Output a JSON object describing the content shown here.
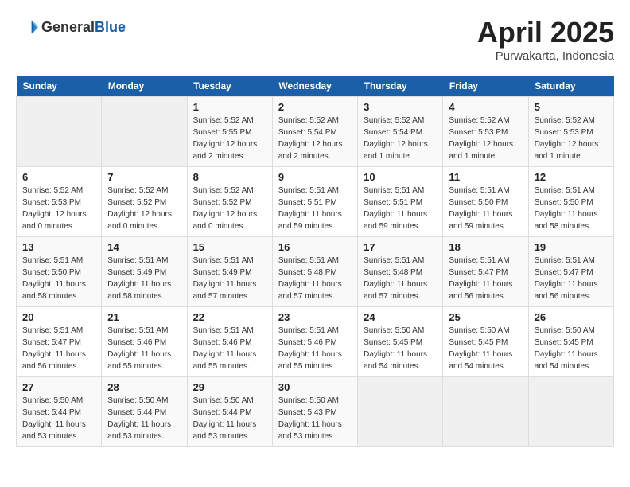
{
  "logo": {
    "text_general": "General",
    "text_blue": "Blue"
  },
  "header": {
    "title": "April 2025",
    "subtitle": "Purwakarta, Indonesia"
  },
  "weekdays": [
    "Sunday",
    "Monday",
    "Tuesday",
    "Wednesday",
    "Thursday",
    "Friday",
    "Saturday"
  ],
  "weeks": [
    [
      {
        "day": "",
        "sunrise": "",
        "sunset": "",
        "daylight": ""
      },
      {
        "day": "",
        "sunrise": "",
        "sunset": "",
        "daylight": ""
      },
      {
        "day": "1",
        "sunrise": "Sunrise: 5:52 AM",
        "sunset": "Sunset: 5:55 PM",
        "daylight": "Daylight: 12 hours and 2 minutes."
      },
      {
        "day": "2",
        "sunrise": "Sunrise: 5:52 AM",
        "sunset": "Sunset: 5:54 PM",
        "daylight": "Daylight: 12 hours and 2 minutes."
      },
      {
        "day": "3",
        "sunrise": "Sunrise: 5:52 AM",
        "sunset": "Sunset: 5:54 PM",
        "daylight": "Daylight: 12 hours and 1 minute."
      },
      {
        "day": "4",
        "sunrise": "Sunrise: 5:52 AM",
        "sunset": "Sunset: 5:53 PM",
        "daylight": "Daylight: 12 hours and 1 minute."
      },
      {
        "day": "5",
        "sunrise": "Sunrise: 5:52 AM",
        "sunset": "Sunset: 5:53 PM",
        "daylight": "Daylight: 12 hours and 1 minute."
      }
    ],
    [
      {
        "day": "6",
        "sunrise": "Sunrise: 5:52 AM",
        "sunset": "Sunset: 5:53 PM",
        "daylight": "Daylight: 12 hours and 0 minutes."
      },
      {
        "day": "7",
        "sunrise": "Sunrise: 5:52 AM",
        "sunset": "Sunset: 5:52 PM",
        "daylight": "Daylight: 12 hours and 0 minutes."
      },
      {
        "day": "8",
        "sunrise": "Sunrise: 5:52 AM",
        "sunset": "Sunset: 5:52 PM",
        "daylight": "Daylight: 12 hours and 0 minutes."
      },
      {
        "day": "9",
        "sunrise": "Sunrise: 5:51 AM",
        "sunset": "Sunset: 5:51 PM",
        "daylight": "Daylight: 11 hours and 59 minutes."
      },
      {
        "day": "10",
        "sunrise": "Sunrise: 5:51 AM",
        "sunset": "Sunset: 5:51 PM",
        "daylight": "Daylight: 11 hours and 59 minutes."
      },
      {
        "day": "11",
        "sunrise": "Sunrise: 5:51 AM",
        "sunset": "Sunset: 5:50 PM",
        "daylight": "Daylight: 11 hours and 59 minutes."
      },
      {
        "day": "12",
        "sunrise": "Sunrise: 5:51 AM",
        "sunset": "Sunset: 5:50 PM",
        "daylight": "Daylight: 11 hours and 58 minutes."
      }
    ],
    [
      {
        "day": "13",
        "sunrise": "Sunrise: 5:51 AM",
        "sunset": "Sunset: 5:50 PM",
        "daylight": "Daylight: 11 hours and 58 minutes."
      },
      {
        "day": "14",
        "sunrise": "Sunrise: 5:51 AM",
        "sunset": "Sunset: 5:49 PM",
        "daylight": "Daylight: 11 hours and 58 minutes."
      },
      {
        "day": "15",
        "sunrise": "Sunrise: 5:51 AM",
        "sunset": "Sunset: 5:49 PM",
        "daylight": "Daylight: 11 hours and 57 minutes."
      },
      {
        "day": "16",
        "sunrise": "Sunrise: 5:51 AM",
        "sunset": "Sunset: 5:48 PM",
        "daylight": "Daylight: 11 hours and 57 minutes."
      },
      {
        "day": "17",
        "sunrise": "Sunrise: 5:51 AM",
        "sunset": "Sunset: 5:48 PM",
        "daylight": "Daylight: 11 hours and 57 minutes."
      },
      {
        "day": "18",
        "sunrise": "Sunrise: 5:51 AM",
        "sunset": "Sunset: 5:47 PM",
        "daylight": "Daylight: 11 hours and 56 minutes."
      },
      {
        "day": "19",
        "sunrise": "Sunrise: 5:51 AM",
        "sunset": "Sunset: 5:47 PM",
        "daylight": "Daylight: 11 hours and 56 minutes."
      }
    ],
    [
      {
        "day": "20",
        "sunrise": "Sunrise: 5:51 AM",
        "sunset": "Sunset: 5:47 PM",
        "daylight": "Daylight: 11 hours and 56 minutes."
      },
      {
        "day": "21",
        "sunrise": "Sunrise: 5:51 AM",
        "sunset": "Sunset: 5:46 PM",
        "daylight": "Daylight: 11 hours and 55 minutes."
      },
      {
        "day": "22",
        "sunrise": "Sunrise: 5:51 AM",
        "sunset": "Sunset: 5:46 PM",
        "daylight": "Daylight: 11 hours and 55 minutes."
      },
      {
        "day": "23",
        "sunrise": "Sunrise: 5:51 AM",
        "sunset": "Sunset: 5:46 PM",
        "daylight": "Daylight: 11 hours and 55 minutes."
      },
      {
        "day": "24",
        "sunrise": "Sunrise: 5:50 AM",
        "sunset": "Sunset: 5:45 PM",
        "daylight": "Daylight: 11 hours and 54 minutes."
      },
      {
        "day": "25",
        "sunrise": "Sunrise: 5:50 AM",
        "sunset": "Sunset: 5:45 PM",
        "daylight": "Daylight: 11 hours and 54 minutes."
      },
      {
        "day": "26",
        "sunrise": "Sunrise: 5:50 AM",
        "sunset": "Sunset: 5:45 PM",
        "daylight": "Daylight: 11 hours and 54 minutes."
      }
    ],
    [
      {
        "day": "27",
        "sunrise": "Sunrise: 5:50 AM",
        "sunset": "Sunset: 5:44 PM",
        "daylight": "Daylight: 11 hours and 53 minutes."
      },
      {
        "day": "28",
        "sunrise": "Sunrise: 5:50 AM",
        "sunset": "Sunset: 5:44 PM",
        "daylight": "Daylight: 11 hours and 53 minutes."
      },
      {
        "day": "29",
        "sunrise": "Sunrise: 5:50 AM",
        "sunset": "Sunset: 5:44 PM",
        "daylight": "Daylight: 11 hours and 53 minutes."
      },
      {
        "day": "30",
        "sunrise": "Sunrise: 5:50 AM",
        "sunset": "Sunset: 5:43 PM",
        "daylight": "Daylight: 11 hours and 53 minutes."
      },
      {
        "day": "",
        "sunrise": "",
        "sunset": "",
        "daylight": ""
      },
      {
        "day": "",
        "sunrise": "",
        "sunset": "",
        "daylight": ""
      },
      {
        "day": "",
        "sunrise": "",
        "sunset": "",
        "daylight": ""
      }
    ]
  ]
}
